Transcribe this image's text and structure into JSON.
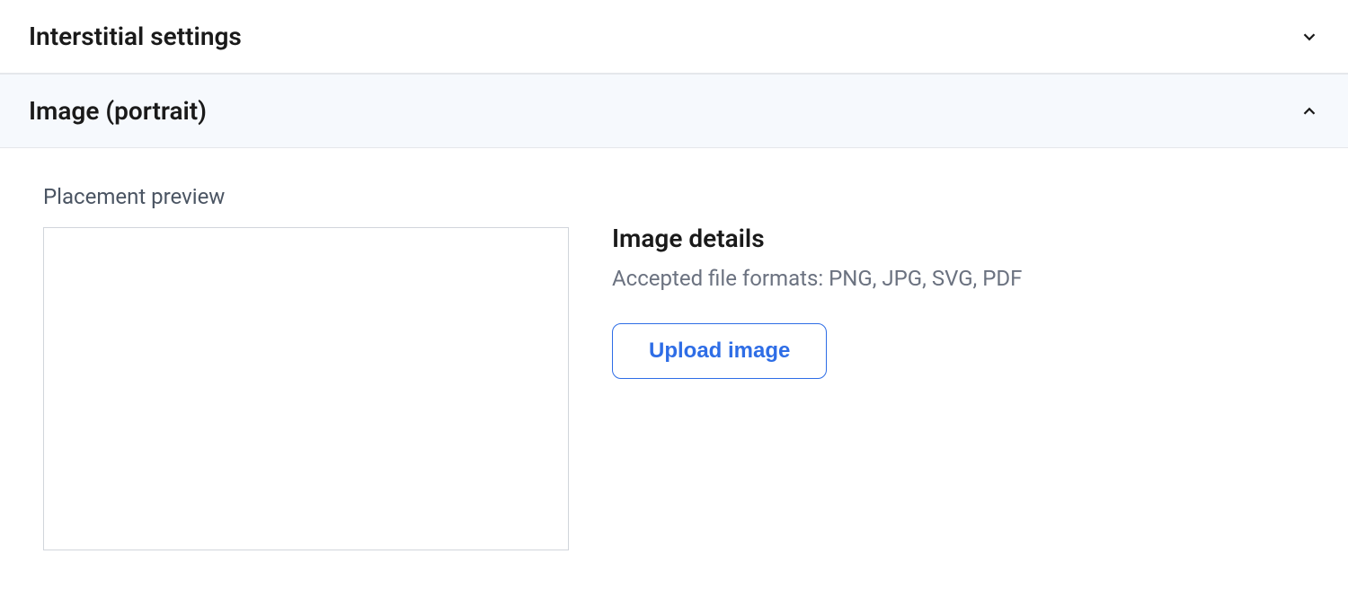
{
  "sections": {
    "interstitial": {
      "title": "Interstitial settings",
      "expanded": false
    },
    "image_portrait": {
      "title": "Image (portrait)",
      "expanded": true,
      "content": {
        "preview_label": "Placement preview",
        "details_title": "Image details",
        "details_subtitle": "Accepted file formats: PNG, JPG, SVG, PDF",
        "upload_button_label": "Upload image"
      }
    }
  }
}
